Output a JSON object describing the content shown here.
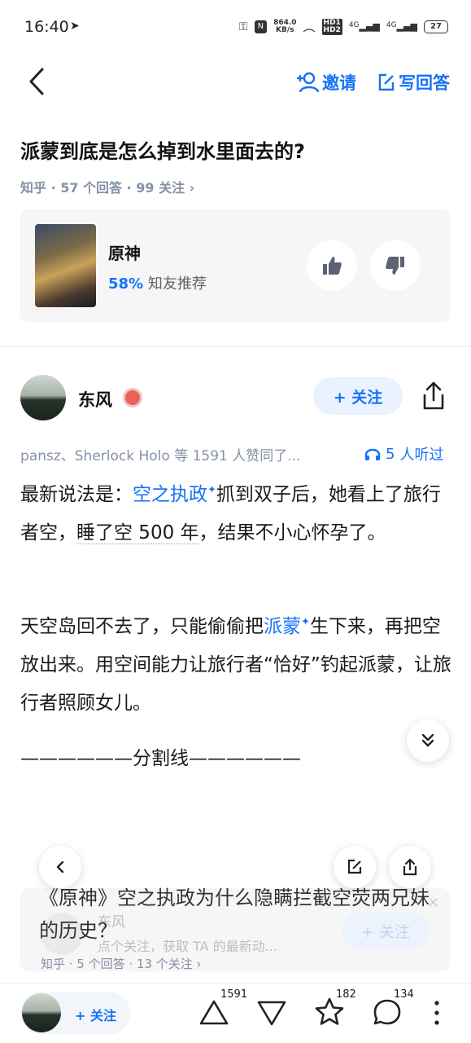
{
  "status_bar": {
    "time": "16:40",
    "speed_top": "864.0",
    "speed_bottom": "KB/s",
    "hd1": "HD1",
    "hd2": "HD2",
    "net1": "4G",
    "net2": "4G",
    "battery": "27",
    "nfc": "N"
  },
  "header": {
    "invite_label": "邀请",
    "write_label": "写回答"
  },
  "question": {
    "title": "派蒙到底是怎么掉到水里面去的?",
    "meta": "知乎 · 57  个回答 · 99  关注 ›"
  },
  "topic_card": {
    "name": "原神",
    "rec_pct": "58%",
    "rec_text": " 知友推荐"
  },
  "answer": {
    "author": "东风",
    "follow_label": "+ 关注",
    "likers": "pansz、Sherlock  Holo  等  1591  人赞同了...",
    "listen_count": "5",
    "listen_text": "人听过",
    "p1_a": "最新说法是：",
    "p1_link": "空之执政",
    "p1_b": "抓到双子后，她看上了旅行者空，",
    "p1_dotted": "睡了空 500 年",
    "p1_c": "，结果不小心怀孕了。",
    "p2_a": "天空岛回不去了，只能偷偷把",
    "p2_link": "派蒙",
    "p2_b": "生下来，再把空放出来。用空间能力让旅行者“恰好”钓起派蒙，让旅行者照顾女儿。",
    "p3": "——————分割线——————"
  },
  "next_card": {
    "title": "《原神》空之执政为什么隐瞒拦截空荧两兄妹的历史？",
    "meta": "知乎 · 5 个回答 · 13 个关注 ›",
    "ghost_name": "东风",
    "ghost_tip": "点个关注，获取  TA  的最新动...",
    "ghost_follow": "+ 关注",
    "close": "×"
  },
  "bottom_bar": {
    "follow_label": "+ 关注",
    "upvote_count": "1591",
    "favorite_count": "182",
    "comment_count": "134"
  },
  "colors": {
    "accent": "#1772f6",
    "meta": "#8590a6"
  }
}
